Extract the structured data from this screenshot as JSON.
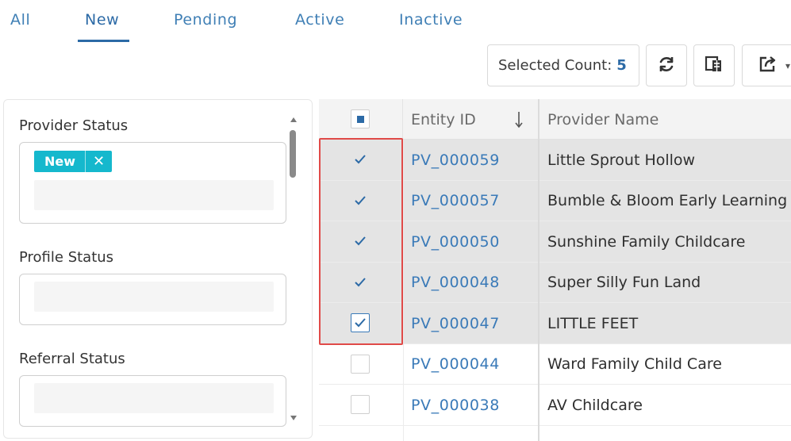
{
  "tabs": [
    {
      "label": "All"
    },
    {
      "label": "New"
    },
    {
      "label": "Pending"
    },
    {
      "label": "Active"
    },
    {
      "label": "Inactive"
    }
  ],
  "active_tab": "New",
  "toolbar": {
    "selected_count_label": "Selected Count:",
    "selected_count_value": "5",
    "refresh_icon": "refresh-icon",
    "columns_icon": "column-chooser-icon",
    "export_icon": "export-icon"
  },
  "filters": {
    "provider_status": {
      "label": "Provider Status",
      "chips": [
        "New"
      ]
    },
    "profile_status": {
      "label": "Profile Status"
    },
    "referral_status": {
      "label": "Referral Status"
    }
  },
  "grid": {
    "columns": {
      "entity_id": "Entity ID",
      "provider_name": "Provider Name"
    },
    "sort_icon": "sort-descending-icon",
    "rows": [
      {
        "entity_id": "PV_000059",
        "provider_name": "Little Sprout Hollow",
        "selected": true
      },
      {
        "entity_id": "PV_000057",
        "provider_name": "Bumble & Bloom Early Learning",
        "selected": true
      },
      {
        "entity_id": "PV_000050",
        "provider_name": "Sunshine Family Childcare",
        "selected": true
      },
      {
        "entity_id": "PV_000048",
        "provider_name": "Super Silly Fun Land",
        "selected": true
      },
      {
        "entity_id": "PV_000047",
        "provider_name": "LITTLE FEET",
        "selected": true
      },
      {
        "entity_id": "PV_000044",
        "provider_name": "Ward Family Child Care",
        "selected": false
      },
      {
        "entity_id": "PV_000038",
        "provider_name": "AV Childcare",
        "selected": false
      }
    ]
  },
  "colors": {
    "accent": "#2c6aa6",
    "link": "#3a7ab8",
    "chip": "#15b8cd",
    "selected_row": "#e4e4e4",
    "highlight": "#e04a48"
  }
}
